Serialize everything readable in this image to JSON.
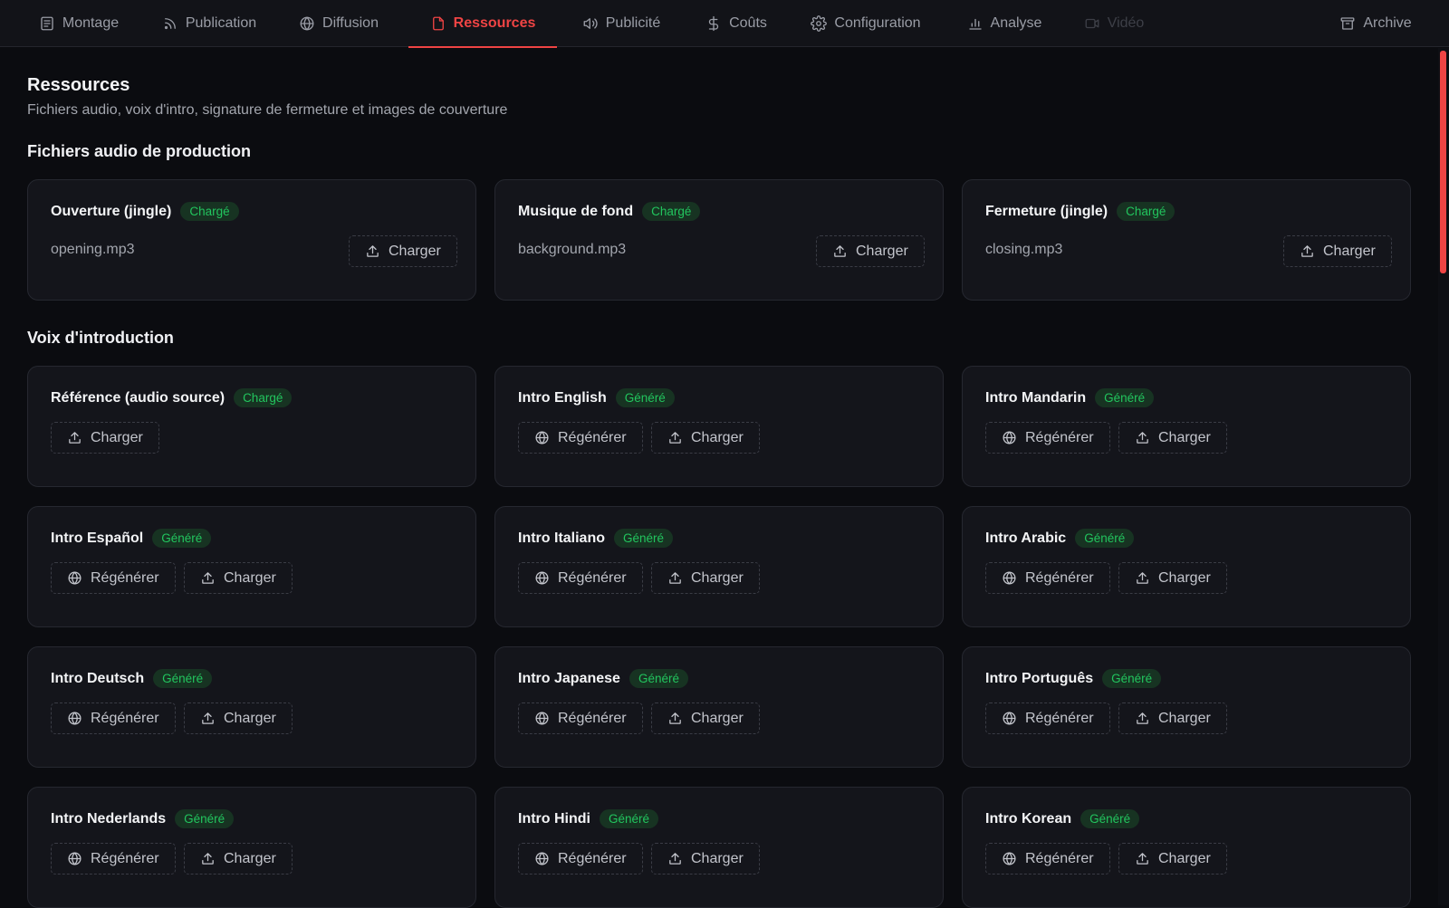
{
  "nav": {
    "tabs": [
      {
        "label": "Montage",
        "icon": "document-list-icon"
      },
      {
        "label": "Publication",
        "icon": "rss-icon"
      },
      {
        "label": "Diffusion",
        "icon": "globe-icon"
      },
      {
        "label": "Ressources",
        "icon": "file-icon",
        "active": true
      },
      {
        "label": "Publicité",
        "icon": "speaker-icon"
      },
      {
        "label": "Coûts",
        "icon": "dollar-icon"
      },
      {
        "label": "Configuration",
        "icon": "gear-icon"
      },
      {
        "label": "Analyse",
        "icon": "bar-chart-icon"
      },
      {
        "label": "Vidéo",
        "icon": "video-icon",
        "disabled": true
      }
    ],
    "archive_label": "Archive"
  },
  "page": {
    "title": "Ressources",
    "subtitle": "Fichiers audio, voix d'intro, signature de fermeture et images de couverture"
  },
  "production": {
    "title": "Fichiers audio de production",
    "cards": [
      {
        "title": "Ouverture (jingle)",
        "badge": "Chargé",
        "file": "opening.mp3",
        "upload_label": "Charger"
      },
      {
        "title": "Musique de fond",
        "badge": "Chargé",
        "file": "background.mp3",
        "upload_label": "Charger"
      },
      {
        "title": "Fermeture (jingle)",
        "badge": "Chargé",
        "file": "closing.mp3",
        "upload_label": "Charger"
      }
    ]
  },
  "intros": {
    "title": "Voix d'introduction",
    "reference": {
      "title": "Référence (audio source)",
      "badge": "Chargé",
      "upload_label": "Charger"
    },
    "cards": [
      {
        "title": "Intro English",
        "badge": "Généré",
        "regen_label": "Régénérer",
        "upload_label": "Charger"
      },
      {
        "title": "Intro Mandarin",
        "badge": "Généré",
        "regen_label": "Régénérer",
        "upload_label": "Charger"
      },
      {
        "title": "Intro Español",
        "badge": "Généré",
        "regen_label": "Régénérer",
        "upload_label": "Charger"
      },
      {
        "title": "Intro Italiano",
        "badge": "Généré",
        "regen_label": "Régénérer",
        "upload_label": "Charger"
      },
      {
        "title": "Intro Arabic",
        "badge": "Généré",
        "regen_label": "Régénérer",
        "upload_label": "Charger"
      },
      {
        "title": "Intro Deutsch",
        "badge": "Généré",
        "regen_label": "Régénérer",
        "upload_label": "Charger"
      },
      {
        "title": "Intro Japanese",
        "badge": "Généré",
        "regen_label": "Régénérer",
        "upload_label": "Charger"
      },
      {
        "title": "Intro Português",
        "badge": "Généré",
        "regen_label": "Régénérer",
        "upload_label": "Charger"
      },
      {
        "title": "Intro Nederlands",
        "badge": "Généré",
        "regen_label": "Régénérer",
        "upload_label": "Charger"
      },
      {
        "title": "Intro Hindi",
        "badge": "Généré",
        "regen_label": "Régénérer",
        "upload_label": "Charger"
      },
      {
        "title": "Intro Korean",
        "badge": "Généré",
        "regen_label": "Régénérer",
        "upload_label": "Charger"
      }
    ]
  },
  "colors": {
    "accent": "#ef4444",
    "success": "#22c55e",
    "background": "#0b0c10",
    "card": "#14151b"
  }
}
